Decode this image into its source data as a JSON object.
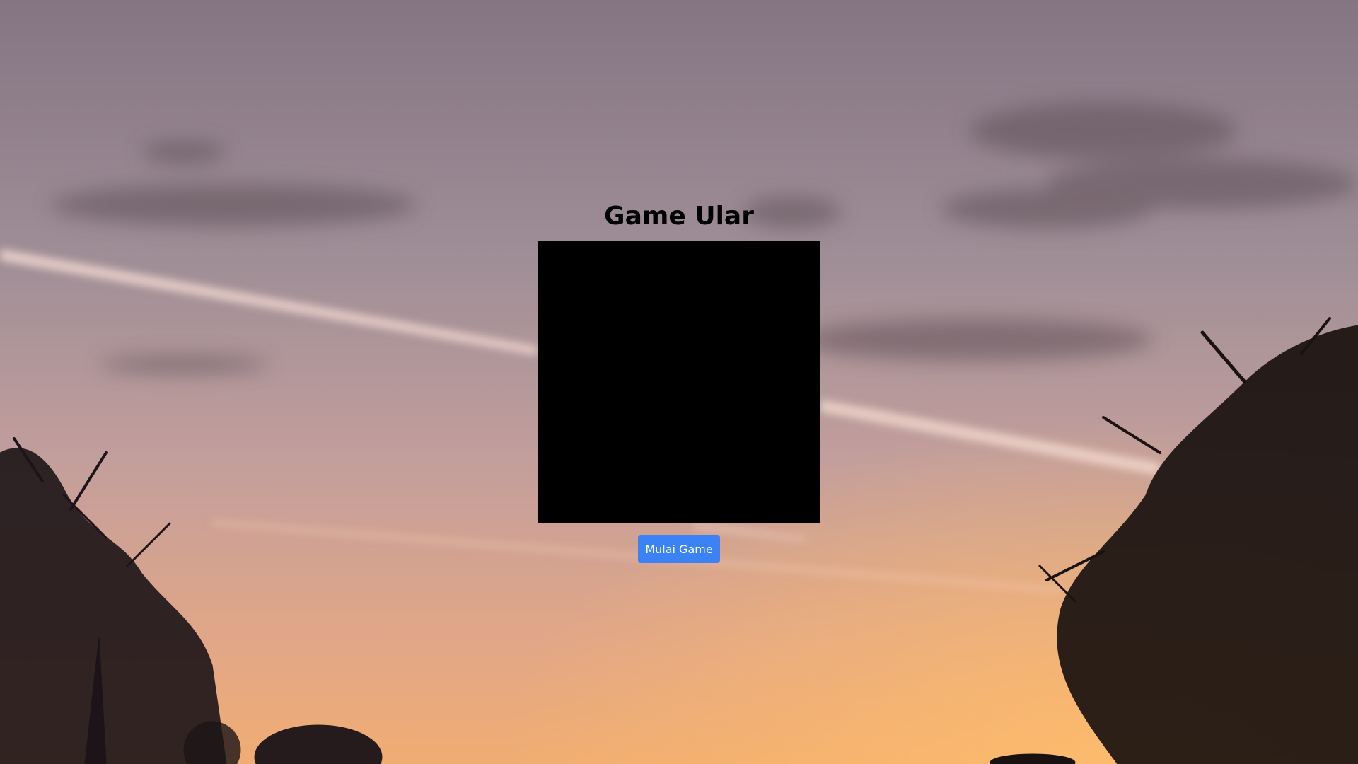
{
  "page": {
    "title": "Game Ular"
  },
  "game": {
    "board_color": "#000000"
  },
  "controls": {
    "start_label": "Mulai Game",
    "start_color": "#3b82f6"
  },
  "background": {
    "scene": "sunset-sky-with-tree-silhouettes",
    "sky_top": "#8a7b88",
    "sky_mid": "#b89a9a",
    "sky_bottom": "#f2a872"
  }
}
